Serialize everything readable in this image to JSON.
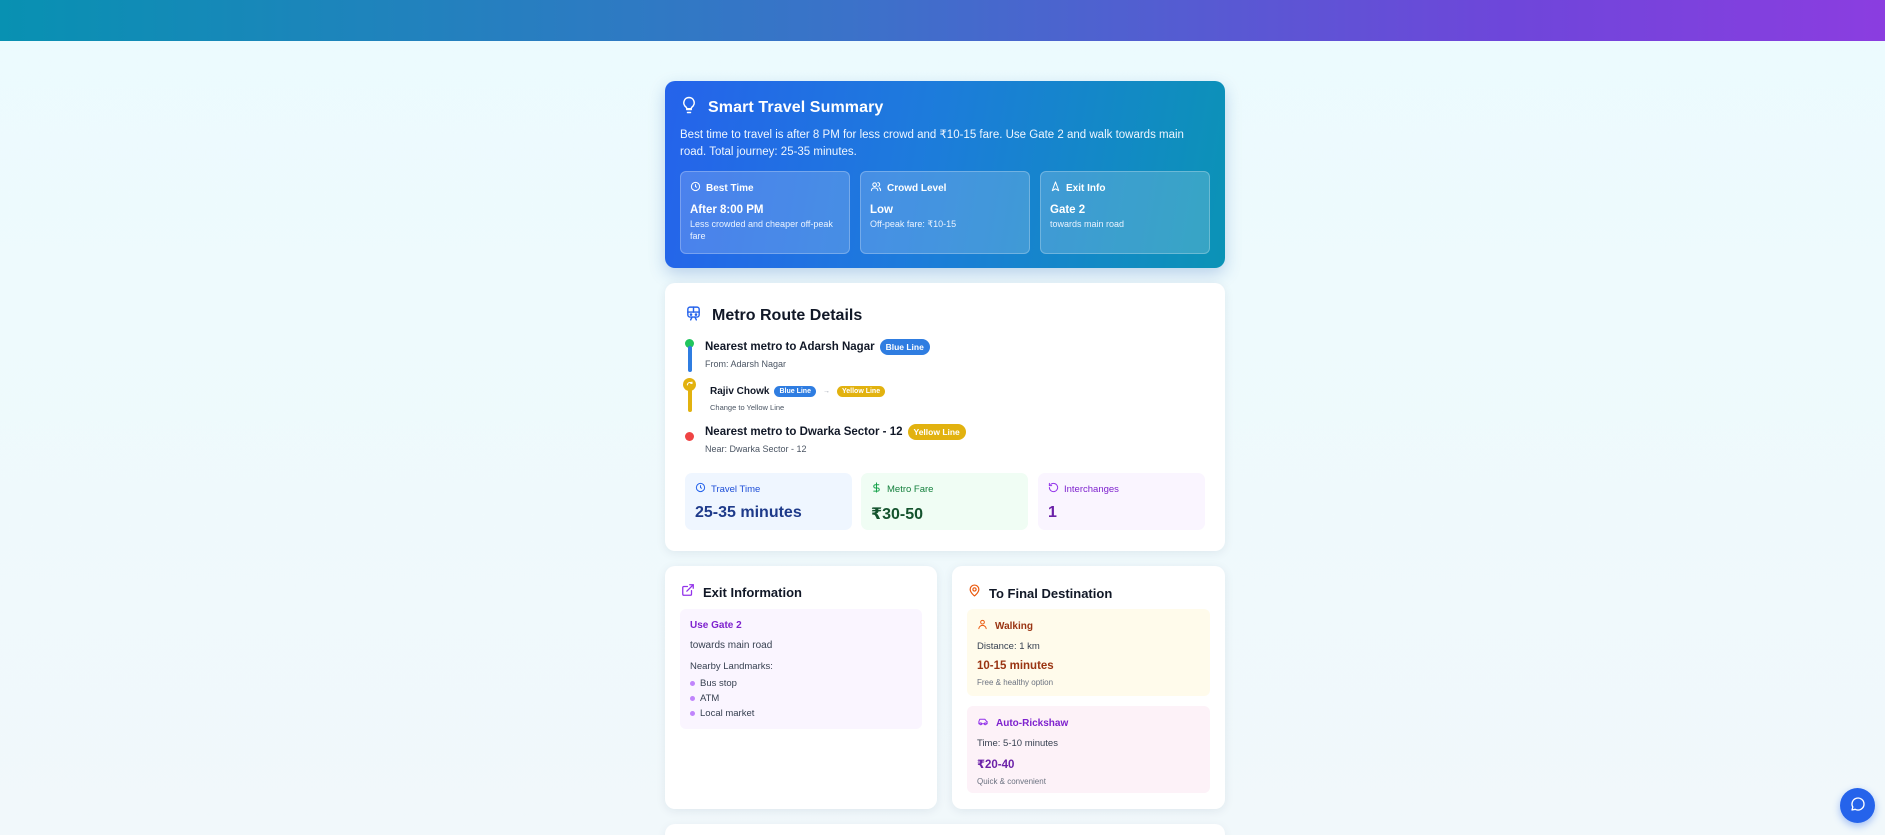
{
  "summary": {
    "title": "Smart Travel Summary",
    "description": "Best time to travel is after 8 PM for less crowd and ₹10-15 fare. Use Gate 2 and walk towards main road. Total journey: 25-35 minutes.",
    "cards": [
      {
        "label": "Best Time",
        "value": "After 8:00 PM",
        "detail": "Less crowded and cheaper off-peak fare",
        "icon": "clock-icon"
      },
      {
        "label": "Crowd Level",
        "value": "Low",
        "detail": "Off-peak fare: ₹10-15",
        "icon": "users-icon"
      },
      {
        "label": "Exit Info",
        "value": "Gate 2",
        "detail": "towards main road",
        "icon": "navigation-icon"
      }
    ]
  },
  "route": {
    "title": "Metro Route Details",
    "stops": [
      {
        "name": "Nearest metro to Adarsh Nagar",
        "badge": "Blue Line",
        "sub": "From: Adarsh Nagar"
      },
      {
        "name": "Rajiv Chowk",
        "badge1": "Blue Line",
        "arrow": "→",
        "badge2": "Yellow Line",
        "sub": "Change to Yellow Line"
      },
      {
        "name": "Nearest metro to Dwarka Sector - 12",
        "badge": "Yellow Line",
        "sub": "Near: Dwarka Sector - 12"
      }
    ],
    "stats": [
      {
        "label": "Travel Time",
        "value": "25-35 minutes"
      },
      {
        "label": "Metro Fare",
        "value": "₹30-50"
      },
      {
        "label": "Interchanges",
        "value": "1"
      }
    ]
  },
  "exit": {
    "title": "Exit Information",
    "gate": "Use Gate 2",
    "towards": "towards main road",
    "landmarks_label": "Nearby Landmarks:",
    "landmarks": [
      "Bus stop",
      "ATM",
      "Local market"
    ]
  },
  "destination": {
    "title": "To Final Destination",
    "walking": {
      "label": "Walking",
      "line": "Distance: 1 km",
      "value": "10-15 minutes",
      "note": "Free & healthy option"
    },
    "rickshaw": {
      "label": "Auto-Rickshaw",
      "line": "Time: 5-10 minutes",
      "value": "₹20-40",
      "note": "Quick & convenient"
    }
  },
  "colors": {
    "blue_line": "#2f7de1",
    "yellow_line": "#e2b20f",
    "accent": "#2563eb"
  }
}
